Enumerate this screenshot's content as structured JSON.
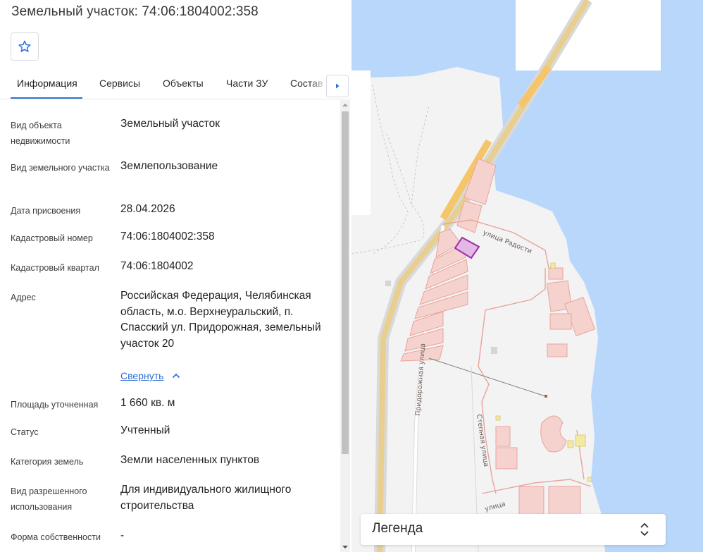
{
  "header": {
    "title": "Земельный участок: 74:06:1804002:358"
  },
  "favorite": {
    "icon": "star-icon"
  },
  "tabs": [
    {
      "label": "Информация",
      "active": true
    },
    {
      "label": "Сервисы",
      "active": false
    },
    {
      "label": "Объекты",
      "active": false
    },
    {
      "label": "Части ЗУ",
      "active": false
    },
    {
      "label": "Состав",
      "active": false
    }
  ],
  "tab_next_icon": "caret-right-icon",
  "info": {
    "object_type": {
      "label": "Вид объекта недвижимости",
      "value": "Земельный участок"
    },
    "land_type": {
      "label": "Вид земельного участка",
      "value": "Землепользование"
    },
    "date": {
      "label": "Дата присвоения",
      "value": "28.04.2026"
    },
    "cad_number": {
      "label": "Кадастровый номер",
      "value": "74:06:1804002:358"
    },
    "cad_quarter": {
      "label": "Кадастровый квартал",
      "value": "74:06:1804002"
    },
    "address": {
      "label": "Адрес",
      "value": "Российская Федерация, Челябинская область, м.о. Верхнеуральский, п. Спасский ул. Придорожная, земельный участок 20"
    },
    "collapse_label": "Свернуть",
    "area": {
      "label": "Площадь уточненная",
      "value": "1 660 кв. м"
    },
    "status": {
      "label": "Статус",
      "value": "Учтенный"
    },
    "category": {
      "label": "Категория земель",
      "value": "Земли населенных пунктов"
    },
    "permitted_use": {
      "label": "Вид разрешенного использования",
      "value": "Для индивидуального жилищного строительства"
    },
    "ownership": {
      "label": "Форма собственности",
      "value": "-"
    }
  },
  "map": {
    "streets": {
      "radosti": "улица Радости",
      "pridorozhnaya": "Придорожная улица",
      "stepnaya": "Степная улица",
      "bottom": "улица"
    },
    "colors": {
      "water": "#b9d7fb",
      "land": "#f3f3f3",
      "parcel": "#f6d2cf",
      "parcel_stroke": "#e9a39b",
      "highlight": "#9b2fa8",
      "road": "#e8cf8f"
    }
  },
  "legend": {
    "title": "Легенда",
    "toggle_icon": "expand-collapse-icon"
  }
}
